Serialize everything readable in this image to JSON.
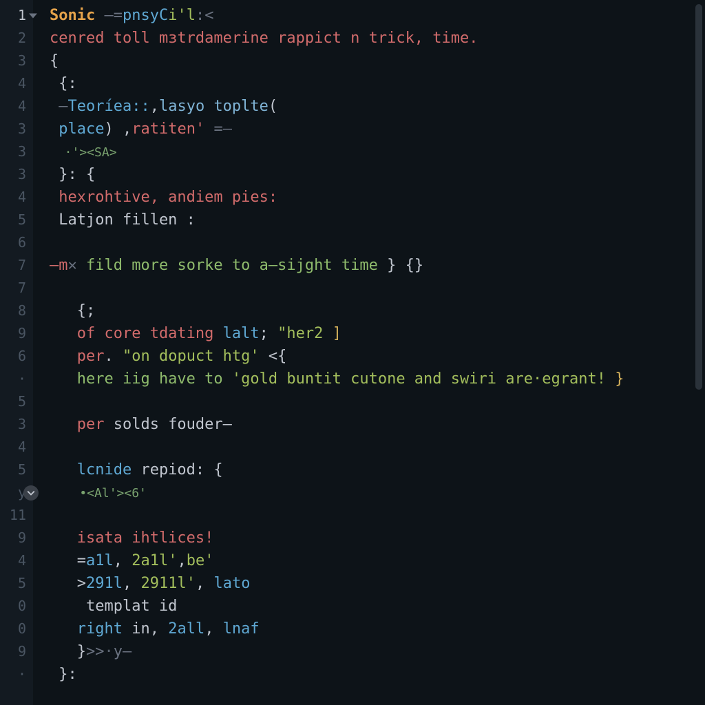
{
  "gutter": {
    "lines": [
      "1",
      "2",
      "3",
      "4",
      "4",
      "3",
      "3",
      "3",
      "4",
      "5",
      "6",
      "7",
      "7",
      "8",
      "9",
      "6",
      "·",
      "5",
      "3",
      "4",
      "5",
      "y",
      "11",
      "9",
      "4",
      "5",
      "0",
      "0",
      "9",
      "·"
    ],
    "active_index": 0,
    "fold_arrow_index": 0,
    "fold_circle_index": 21
  },
  "code": {
    "rows": [
      [
        {
          "t": "Sonic",
          "c": "tk-kw"
        },
        {
          "t": " —=",
          "c": "tk-op"
        },
        {
          "t": "pnsyC",
          "c": "tk-fn"
        },
        {
          "t": "i'l",
          "c": "tk-str"
        },
        {
          "t": ":<",
          "c": "tk-op"
        }
      ],
      [
        {
          "t": "cenred toll m",
          "c": "tk-err"
        },
        {
          "t": "з",
          "c": "tk-err"
        },
        {
          "t": "trdamerine rappict n trick, time.",
          "c": "tk-err"
        }
      ],
      [
        {
          "t": "{",
          "c": "tk-brace"
        }
      ],
      [
        {
          "t": " {:",
          "c": "tk-txt"
        }
      ],
      [
        {
          "t": " –",
          "c": "tk-op"
        },
        {
          "t": "Teoríea::",
          "c": "tk-fn"
        },
        {
          "t": ",",
          "c": "tk-txt"
        },
        {
          "t": "lasyo toplte",
          "c": "tk-fn2"
        },
        {
          "t": "(",
          "c": "tk-txt"
        }
      ],
      [
        {
          "t": " place",
          "c": "tk-fn"
        },
        {
          "t": ") ,",
          "c": "tk-txt"
        },
        {
          "t": "ratiten'",
          "c": "tk-err"
        },
        {
          "t": " =–",
          "c": "tk-op"
        }
      ],
      [
        {
          "t": "  ·'><SA>",
          "c": "tk-tag small"
        }
      ],
      [
        {
          "t": " }: {",
          "c": "tk-txt"
        }
      ],
      [
        {
          "t": " hexrohtive, andiem pies:",
          "c": "tk-err"
        }
      ],
      [
        {
          "t": " Latjon fillen :",
          "c": "tk-txt"
        }
      ],
      [
        {
          "t": "",
          "c": "tk-txt"
        }
      ],
      [
        {
          "t": "–m",
          "c": "tk-err"
        },
        {
          "t": "✕",
          "c": "tk-op"
        },
        {
          "t": " ",
          "c": "tk-txt"
        },
        {
          "t": "fild more sorke to a–sijght time",
          "c": "tk-green2"
        },
        {
          "t": " } {}",
          "c": "tk-txt"
        }
      ],
      [
        {
          "t": "",
          "c": "tk-txt"
        }
      ],
      [
        {
          "t": "   {;",
          "c": "tk-txt"
        }
      ],
      [
        {
          "t": "   of core tdating ",
          "c": "tk-err"
        },
        {
          "t": "lalt",
          "c": "tk-fn"
        },
        {
          "t": "; ",
          "c": "tk-txt"
        },
        {
          "t": "\"her2",
          "c": "tk-str"
        },
        {
          "t": " ]",
          "c": "tk-yellow"
        }
      ],
      [
        {
          "t": "   per",
          "c": "tk-err"
        },
        {
          "t": ". ",
          "c": "tk-txt"
        },
        {
          "t": "\"on doрuct htg'",
          "c": "tk-str"
        },
        {
          "t": " <{",
          "c": "tk-txt"
        }
      ],
      [
        {
          "t": "   here iig have to ",
          "c": "tk-green2"
        },
        {
          "t": "'gold buntit cutone and swiri are·egrant!",
          "c": "tk-str"
        },
        {
          "t": " }",
          "c": "tk-yellow"
        }
      ],
      [
        {
          "t": "",
          "c": "tk-txt"
        }
      ],
      [
        {
          "t": "   per ",
          "c": "tk-err"
        },
        {
          "t": "solds fouder–",
          "c": "tk-txt"
        }
      ],
      [
        {
          "t": "",
          "c": "tk-txt"
        }
      ],
      [
        {
          "t": "   lcnide ",
          "c": "tk-fn"
        },
        {
          "t": "repiod: {",
          "c": "tk-txt"
        }
      ],
      [
        {
          "t": "    •<Al'><6'",
          "c": "tk-tag small"
        }
      ],
      [
        {
          "t": "",
          "c": "tk-txt"
        }
      ],
      [
        {
          "t": "   isata ihtlices!",
          "c": "tk-err"
        }
      ],
      [
        {
          "t": "   =",
          "c": "tk-txt"
        },
        {
          "t": "a1l",
          "c": "tk-fn"
        },
        {
          "t": ", ",
          "c": "tk-txt"
        },
        {
          "t": "2a1l'",
          "c": "tk-str"
        },
        {
          "t": ",",
          "c": "tk-txt"
        },
        {
          "t": "be'",
          "c": "tk-str"
        }
      ],
      [
        {
          "t": "   >",
          "c": "tk-txt"
        },
        {
          "t": "291l",
          "c": "tk-fn"
        },
        {
          "t": ", ",
          "c": "tk-txt"
        },
        {
          "t": "2911l'",
          "c": "tk-str"
        },
        {
          "t": ", ",
          "c": "tk-txt"
        },
        {
          "t": "lato",
          "c": "tk-fn"
        }
      ],
      [
        {
          "t": "    templat id",
          "c": "tk-txt"
        }
      ],
      [
        {
          "t": "   right ",
          "c": "tk-fn"
        },
        {
          "t": "in, ",
          "c": "tk-txt"
        },
        {
          "t": "2all",
          "c": "tk-fn"
        },
        {
          "t": ", ",
          "c": "tk-txt"
        },
        {
          "t": "lnaf",
          "c": "tk-fn"
        }
      ],
      [
        {
          "t": "   }",
          "c": "tk-txt"
        },
        {
          "t": ">>",
          "c": "tk-op"
        },
        {
          "t": "·",
          "c": "tk-dim"
        },
        {
          "t": "y–",
          "c": "tk-op"
        }
      ],
      [
        {
          "t": " }:",
          "c": "tk-txt"
        }
      ]
    ]
  }
}
